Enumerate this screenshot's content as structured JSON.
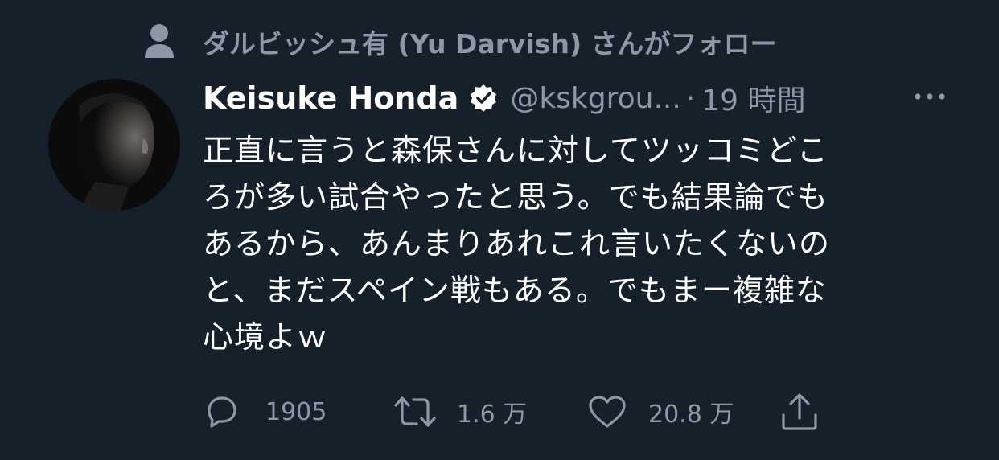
{
  "social_context": {
    "icon": "person-icon",
    "text": "ダルビッシュ有 (Yu Darvish) さんがフォロー"
  },
  "tweet": {
    "avatar": "profile-photo",
    "display_name": "Keisuke Honda",
    "verified_icon": "verified-badge-icon",
    "handle": "@kskgrou...",
    "separator": "·",
    "timestamp": "19 時間",
    "more_icon": "more-options-icon",
    "text_lines": [
      "正直に言うと森保さんに対してツッコミどこ",
      "ろが多い試合やったと思う。でも結果論でも",
      "あるから、あんまりあれこれ言いたくないの",
      "と、まだスペイン戦もある。でもまー複雑な",
      "心境よｗ"
    ]
  },
  "actions": {
    "reply": {
      "icon": "reply-icon",
      "count": "1905"
    },
    "retweet": {
      "icon": "retweet-icon",
      "count": "1.6 万"
    },
    "like": {
      "icon": "heart-icon",
      "count": "20.8 万"
    },
    "share": {
      "icon": "share-icon"
    }
  },
  "colors": {
    "background": "#15202b",
    "primary_text": "#ffffff",
    "secondary_text": "#8b98a5"
  }
}
